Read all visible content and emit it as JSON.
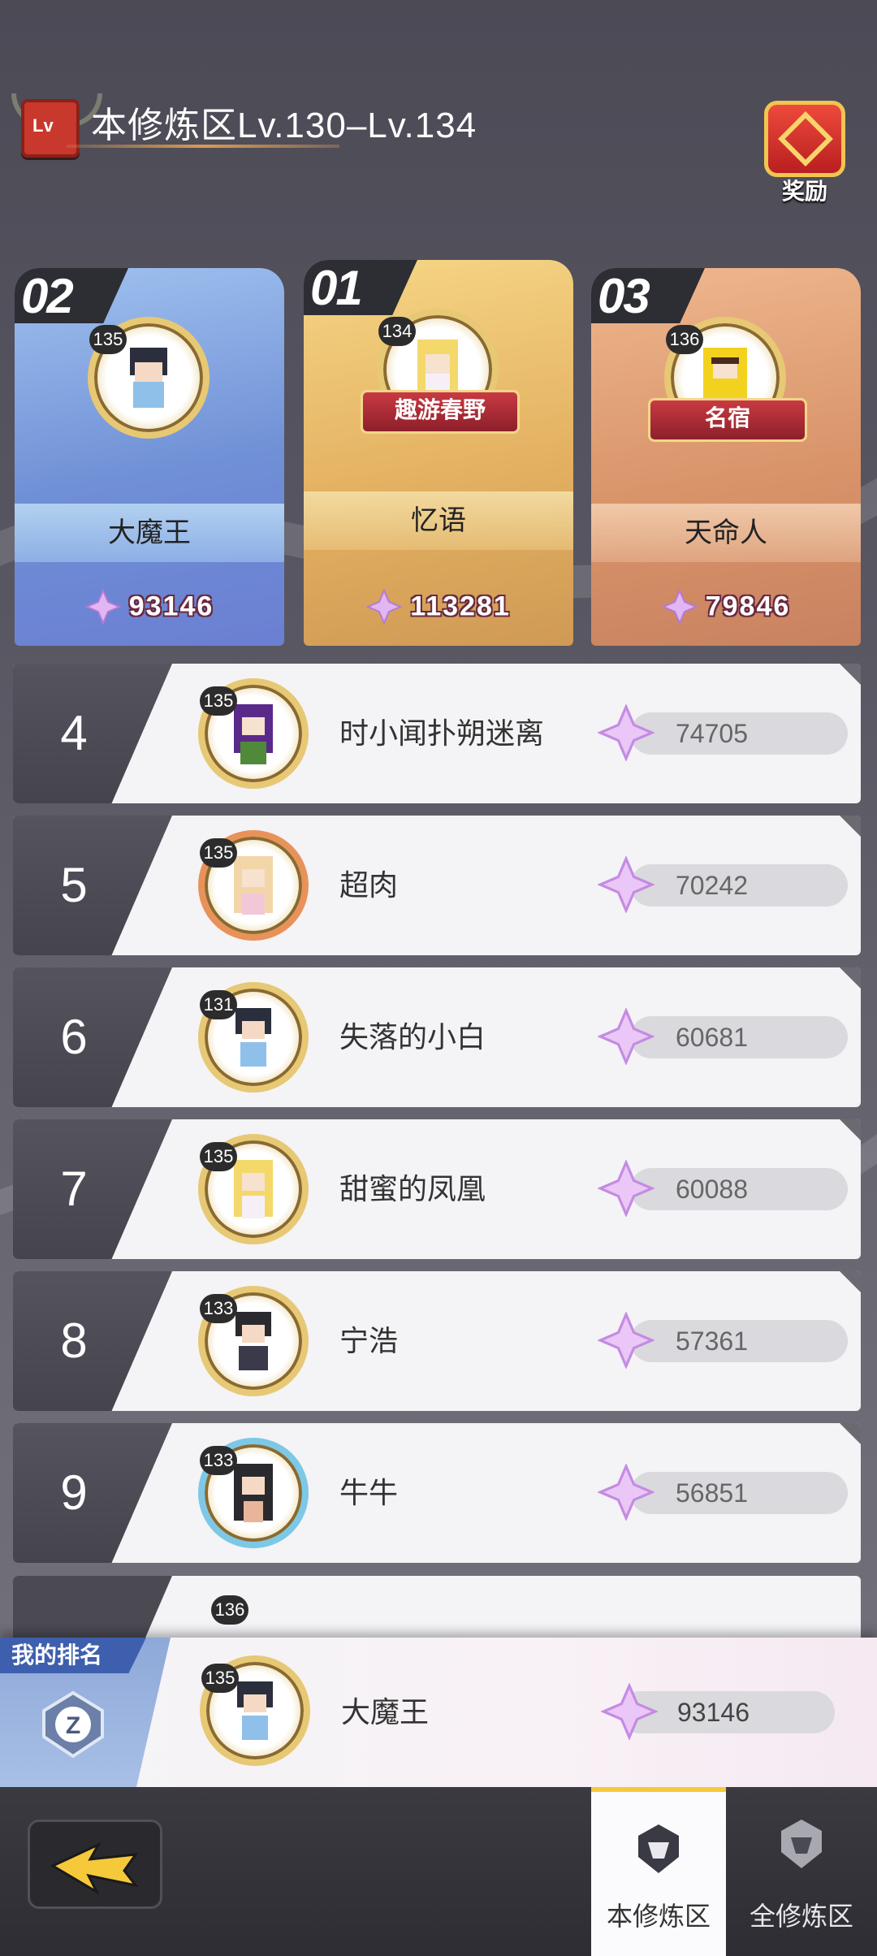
{
  "header": {
    "title": "本修炼区Lv.130–Lv.134",
    "reward_label": "奖励",
    "level_icon": "Lv"
  },
  "podium": [
    {
      "rank_label": "02",
      "level": "135",
      "name": "大魔王",
      "score": "93146",
      "title_plaque": ""
    },
    {
      "rank_label": "01",
      "level": "134",
      "name": "忆语",
      "score": "113281",
      "title_plaque": "趣游春野"
    },
    {
      "rank_label": "03",
      "level": "136",
      "name": "天命人",
      "score": "79846",
      "title_plaque": "名宿"
    }
  ],
  "rows": [
    {
      "rank": "4",
      "level": "135",
      "name": "时小闻扑朔迷离",
      "score": "74705"
    },
    {
      "rank": "5",
      "level": "135",
      "name": "超肉",
      "score": "70242"
    },
    {
      "rank": "6",
      "level": "131",
      "name": "失落的小白",
      "score": "60681"
    },
    {
      "rank": "7",
      "level": "135",
      "name": "甜蜜的凤凰",
      "score": "60088"
    },
    {
      "rank": "8",
      "level": "133",
      "name": "宁浩",
      "score": "57361"
    },
    {
      "rank": "9",
      "level": "133",
      "name": "牛牛",
      "score": "56851"
    }
  ],
  "partial_row": {
    "level": "136"
  },
  "my_rank": {
    "tag": "我的排名",
    "level": "135",
    "name": "大魔王",
    "score": "93146"
  },
  "tabs": {
    "current_zone": "本修炼区",
    "all_zones": "全修炼区"
  },
  "colors": {
    "accent_gold": "#f6c93a",
    "crystal_purple": "#c98be6"
  }
}
